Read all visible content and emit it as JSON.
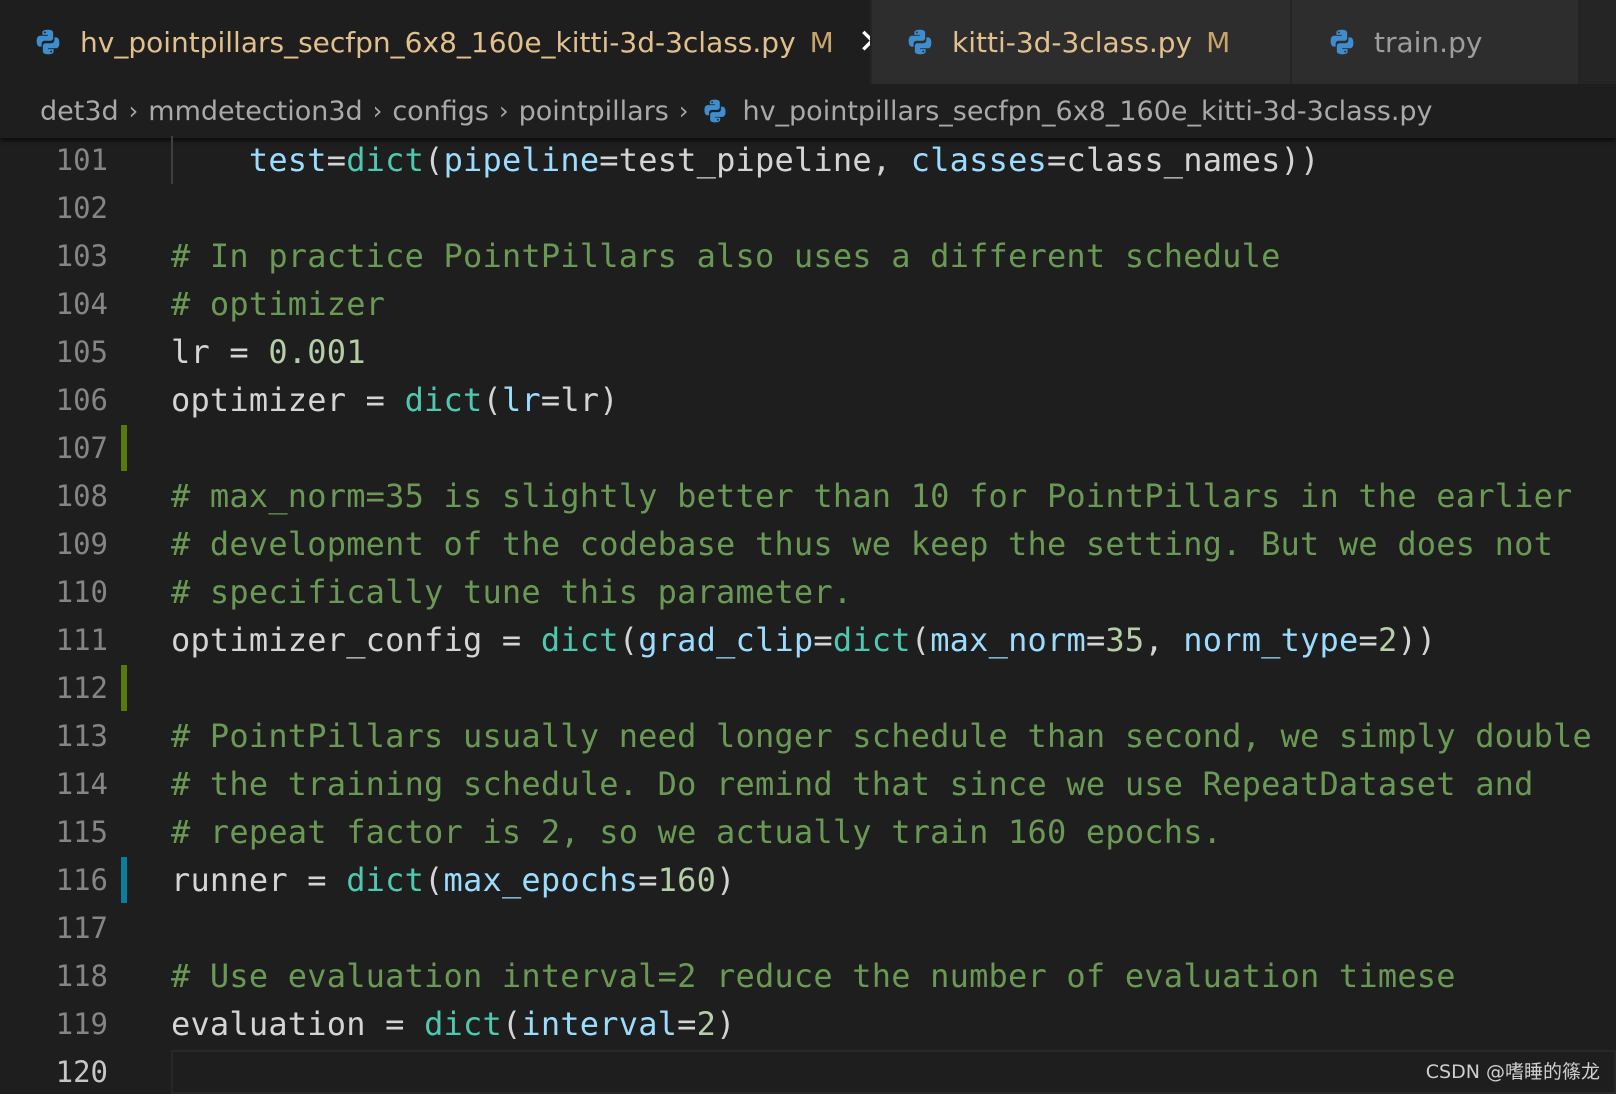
{
  "tabs": [
    {
      "label": "hv_pointpillars_secfpn_6x8_160e_kitti-3d-3class.py",
      "modified": "M",
      "close": "✕",
      "active": true
    },
    {
      "label": "kitti-3d-3class.py",
      "modified": "M",
      "active": false
    },
    {
      "label": "train.py",
      "active": false
    }
  ],
  "breadcrumb": {
    "items": [
      "det3d",
      "mmdetection3d",
      "configs",
      "pointpillars"
    ],
    "file": "hv_pointpillars_secfpn_6x8_160e_kitti-3d-3class.py",
    "separator": "›"
  },
  "editor": {
    "lines": [
      {
        "num": "101",
        "tokens": [
          [
            "pl",
            "    "
          ],
          [
            "kw",
            "test"
          ],
          [
            "pl",
            "="
          ],
          [
            "fn",
            "dict"
          ],
          [
            "pl",
            "("
          ],
          [
            "kw",
            "pipeline"
          ],
          [
            "pl",
            "=test_pipeline, "
          ],
          [
            "kw",
            "classes"
          ],
          [
            "pl",
            "=class_names))"
          ]
        ]
      },
      {
        "num": "102",
        "tokens": []
      },
      {
        "num": "103",
        "tokens": [
          [
            "cm",
            "# In practice PointPillars also uses a different schedule"
          ]
        ]
      },
      {
        "num": "104",
        "tokens": [
          [
            "cm",
            "# optimizer"
          ]
        ]
      },
      {
        "num": "105",
        "tokens": [
          [
            "pl",
            "lr = "
          ],
          [
            "nm",
            "0.001"
          ]
        ]
      },
      {
        "num": "106",
        "tokens": [
          [
            "pl",
            "optimizer = "
          ],
          [
            "fn",
            "dict"
          ],
          [
            "pl",
            "("
          ],
          [
            "kw",
            "lr"
          ],
          [
            "pl",
            "=lr)"
          ]
        ]
      },
      {
        "num": "107",
        "tokens": [],
        "gutter": "added"
      },
      {
        "num": "108",
        "tokens": [
          [
            "cm",
            "# max_norm=35 is slightly better than 10 for PointPillars in the earlier"
          ]
        ]
      },
      {
        "num": "109",
        "tokens": [
          [
            "cm",
            "# development of the codebase thus we keep the setting. But we does not"
          ]
        ]
      },
      {
        "num": "110",
        "tokens": [
          [
            "cm",
            "# specifically tune this parameter."
          ]
        ]
      },
      {
        "num": "111",
        "tokens": [
          [
            "pl",
            "optimizer_config = "
          ],
          [
            "fn",
            "dict"
          ],
          [
            "pl",
            "("
          ],
          [
            "kw",
            "grad_clip"
          ],
          [
            "pl",
            "="
          ],
          [
            "fn",
            "dict"
          ],
          [
            "pl",
            "("
          ],
          [
            "kw",
            "max_norm"
          ],
          [
            "pl",
            "="
          ],
          [
            "nm",
            "35"
          ],
          [
            "pl",
            ", "
          ],
          [
            "kw",
            "norm_type"
          ],
          [
            "pl",
            "="
          ],
          [
            "nm",
            "2"
          ],
          [
            "pl",
            "))"
          ]
        ]
      },
      {
        "num": "112",
        "tokens": [],
        "gutter": "added"
      },
      {
        "num": "113",
        "tokens": [
          [
            "cm",
            "# PointPillars usually need longer schedule than second, we simply double"
          ]
        ]
      },
      {
        "num": "114",
        "tokens": [
          [
            "cm",
            "# the training schedule. Do remind that since we use RepeatDataset and"
          ]
        ]
      },
      {
        "num": "115",
        "tokens": [
          [
            "cm",
            "# repeat factor is 2, so we actually train 160 epochs."
          ]
        ]
      },
      {
        "num": "116",
        "tokens": [
          [
            "pl",
            "runner = "
          ],
          [
            "fn",
            "dict"
          ],
          [
            "pl",
            "("
          ],
          [
            "kw",
            "max_epochs"
          ],
          [
            "pl",
            "="
          ],
          [
            "nm",
            "160"
          ],
          [
            "pl",
            ")"
          ]
        ],
        "gutter": "modified"
      },
      {
        "num": "117",
        "tokens": []
      },
      {
        "num": "118",
        "tokens": [
          [
            "cm",
            "# Use evaluation interval=2 reduce the number of evaluation timese"
          ]
        ]
      },
      {
        "num": "119",
        "tokens": [
          [
            "pl",
            "evaluation = "
          ],
          [
            "fn",
            "dict"
          ],
          [
            "pl",
            "("
          ],
          [
            "kw",
            "interval"
          ],
          [
            "pl",
            "="
          ],
          [
            "nm",
            "2"
          ],
          [
            "pl",
            ")"
          ]
        ]
      },
      {
        "num": "120",
        "tokens": [],
        "current": true
      }
    ]
  },
  "watermark": "CSDN @嗜睡的篠龙",
  "colors": {
    "added": "#587c0c",
    "modified": "#0c7d9d",
    "keyword": "#9cdcfe",
    "function": "#4ec9b0",
    "comment": "#6a9955",
    "number": "#b5cea8"
  }
}
